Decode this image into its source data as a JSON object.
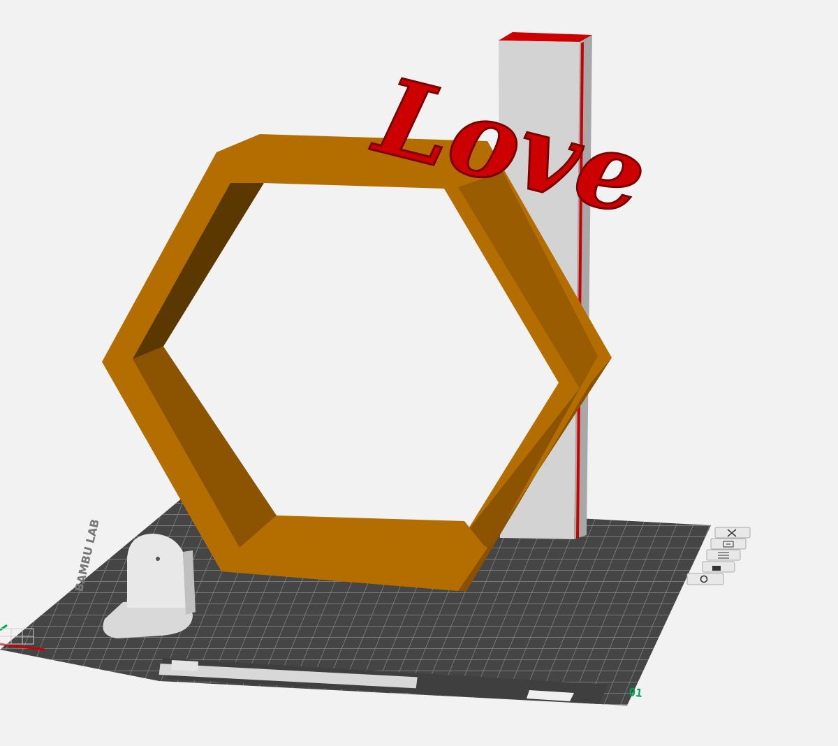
{
  "viewport": {
    "background": "#f2f2f2"
  },
  "models": {
    "hexagon_frame": {
      "name": "hexagon frame",
      "color": "#b46e00"
    },
    "back_pillar": {
      "name": "back pillar",
      "color": "#d3d3d3",
      "edge_color": "#cc0000"
    },
    "love_text": {
      "text": "Love",
      "color": "#cc0000"
    },
    "bracket": {
      "name": "wall bracket",
      "color": "#d9d9d9"
    }
  },
  "build_plate": {
    "color": "#454545",
    "grid_color": "#9a9a9a",
    "plate_number": "01",
    "plate_number_color": "#00a651",
    "side_label": "BAMBU LAB"
  },
  "plate_toolbar": {
    "items": [
      {
        "name": "close-plate",
        "icon": "close-icon"
      },
      {
        "name": "auto-orient",
        "icon": "orient-icon"
      },
      {
        "name": "arrange",
        "icon": "arrange-icon"
      },
      {
        "name": "lock-plate",
        "icon": "lock-icon"
      },
      {
        "name": "plate-settings",
        "icon": "settings-icon"
      }
    ]
  }
}
